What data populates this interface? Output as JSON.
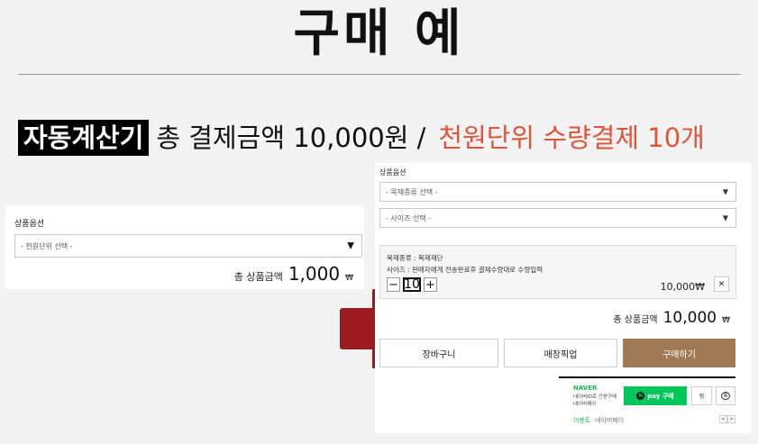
{
  "page": {
    "title": "구매 예",
    "subtitle_tag": "자동계산기",
    "subtitle_main": "총 결제금액 10,000원 /",
    "subtitle_highlight": "천원단위 수량결제 10개"
  },
  "left_panel": {
    "label": "상품옵션",
    "select_value": "- 천원단위 선택 -",
    "total_label": "총 상품금액",
    "total_amount": "1,000",
    "won": "₩"
  },
  "right_panel": {
    "label": "상품옵션",
    "select1": "- 목재종류 선택 -",
    "select2": "- 사이즈 선택 -",
    "option_line1": "목재종류 : 목재재단",
    "option_line2": "사이즈 : 판매자에게 전송완료후 결제수량대로 수량입력",
    "minus": "−",
    "quantity": "10",
    "plus": "+",
    "item_price": "10,000₩",
    "remove": "✕",
    "total_label": "총 상품금액",
    "total_amount": "10,000",
    "won": "₩",
    "buttons": {
      "cart": "장바구니",
      "pickup": "매장픽업",
      "buy": "구매하기"
    },
    "npay": {
      "brand": "NAVER",
      "desc1": "네이버ID로 간편구매",
      "desc2": "네이버페이",
      "pay_label": "pay 구매",
      "pay_logo": "N",
      "zzim": "찜",
      "talk": "톡",
      "event": "이벤트",
      "event_text": "네이버페이",
      "prev": "<",
      "next": ">"
    }
  },
  "colors": {
    "accent_red": "#e0553a",
    "buy_button": "#a07a55",
    "naver_green": "#03c75a",
    "arrow": "#9b1c1f"
  },
  "icons": {
    "dropdown": "chevron-down-icon",
    "arrow": "right-arrow-icon",
    "talk": "chat-bubble-icon"
  }
}
